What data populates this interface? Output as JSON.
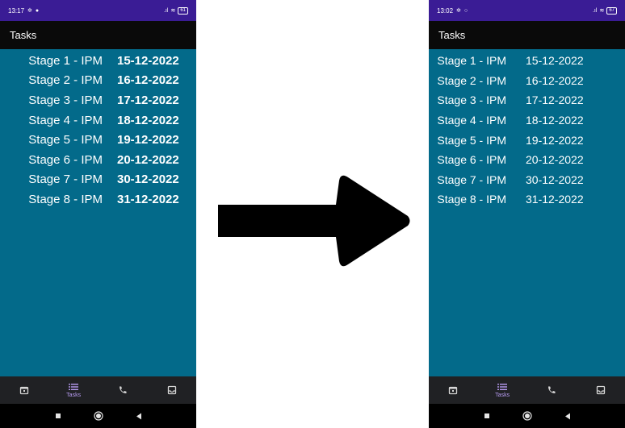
{
  "left_screen": {
    "status": {
      "time": "13:17",
      "battery": "61"
    },
    "app_bar_title": "Tasks",
    "tasks": [
      {
        "name": "Stage 1 - IPM",
        "date": "15-12-2022"
      },
      {
        "name": "Stage 2 - IPM",
        "date": "16-12-2022"
      },
      {
        "name": "Stage 3 - IPM",
        "date": "17-12-2022"
      },
      {
        "name": "Stage 4 - IPM",
        "date": "18-12-2022"
      },
      {
        "name": "Stage 5 - IPM",
        "date": "19-12-2022"
      },
      {
        "name": "Stage 6 - IPM",
        "date": "20-12-2022"
      },
      {
        "name": "Stage 7 - IPM",
        "date": "30-12-2022"
      },
      {
        "name": "Stage 8 - IPM",
        "date": "31-12-2022"
      }
    ],
    "bottom_nav": {
      "tasks_label": "Tasks",
      "active": "tasks"
    }
  },
  "right_screen": {
    "status": {
      "time": "13:02",
      "battery": "67"
    },
    "app_bar_title": "Tasks",
    "tasks": [
      {
        "name": "Stage 1 - IPM",
        "date": "15-12-2022"
      },
      {
        "name": "Stage 2 - IPM",
        "date": "16-12-2022"
      },
      {
        "name": "Stage 3 - IPM",
        "date": "17-12-2022"
      },
      {
        "name": "Stage 4 - IPM",
        "date": "18-12-2022"
      },
      {
        "name": "Stage 5 - IPM",
        "date": "19-12-2022"
      },
      {
        "name": "Stage 6 - IPM",
        "date": "20-12-2022"
      },
      {
        "name": "Stage 7 - IPM",
        "date": "30-12-2022"
      },
      {
        "name": "Stage 8 - IPM",
        "date": "31-12-2022"
      }
    ],
    "bottom_nav": {
      "tasks_label": "Tasks",
      "active": "tasks"
    }
  },
  "icons": {
    "calendar": "calendar-icon",
    "tasks": "list-icon",
    "phone": "phone-icon",
    "inbox": "inbox-icon",
    "arrow": "right-arrow-icon"
  },
  "colors": {
    "background": "#036a8a",
    "status_bar": "#3a1c95",
    "app_bar": "#0a0a0a",
    "bottom_nav": "#202124",
    "nav_active": "#b89cf2"
  }
}
